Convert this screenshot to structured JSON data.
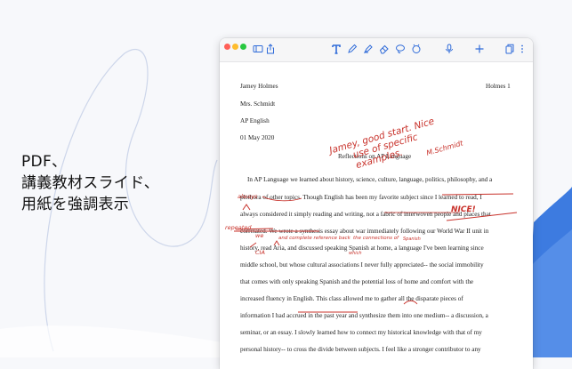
{
  "promo": {
    "line1": "PDF、",
    "line2": "講義教材スライド、",
    "line3": "用紙を強調表示"
  },
  "colors": {
    "accent": "#2f6bd9",
    "ink": "#c8312a",
    "close": "#ff5f57",
    "minimize": "#febc2e",
    "zoom": "#28c840"
  },
  "toolbar": {
    "left_icons": [
      "sidebar-icon",
      "share-icon"
    ],
    "tools": [
      "text-tool-icon",
      "pen-icon",
      "highlighter-icon",
      "eraser-icon",
      "lasso-icon",
      "shapes-icon"
    ],
    "right_icons": [
      "microphone-icon",
      "add-icon",
      "pages-icon",
      "more-icon"
    ]
  },
  "document": {
    "header_left": [
      "Jamey Holmes",
      "Mrs. Schmidt",
      "AP English",
      "01 May 2020"
    ],
    "header_right": "Holmes 1",
    "title": "Reflections on AP Language",
    "body_lines": [
      "In AP Language we learned about history, science, culture, language, politics, philosophy, and a",
      "plethora of other topics. Though English has been my favorite subject since I learned to read, I",
      "always considered it simply reading and writing, not a fabric of interwoven people and places that",
      "correlated. We wrote a synthesis essay about war immediately following our World War II unit in",
      "history, read Aria, and discussed speaking Spanish at home, a language I've been learning since",
      "middle school, but whose cultural associations I never fully appreciated-- the social immobility",
      "that comes with only speaking Spanish and the potential loss of home and comfort with the",
      "increased fluency in English. This class allowed me to gather all the disparate pieces of",
      "information I had accrued in the past year and synthesize them into one medium-- a discussion, a",
      "seminar, or an essay. I slowly learned how to connect my historical knowledge with that of my",
      "personal history-- to cross the divide between subjects. I feel like a stronger contributor to any"
    ]
  },
  "annotations": {
    "teacher_comment": [
      "Jamey, good start. Nice",
      "use of specific",
      "examples."
    ],
    "signature": "M.Schmidt",
    "nice": "NICE!",
    "margin_note_1": "always",
    "margin_note_2": "repeated",
    "insert_1": "we",
    "insert_2": "and complete reference back",
    "insert_3": "the connections of",
    "insert_4": "Spanish",
    "insert_5": "CIA",
    "insert_6": "which"
  }
}
